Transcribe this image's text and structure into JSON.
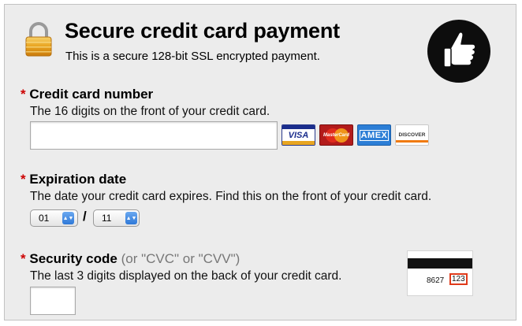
{
  "header": {
    "title": "Secure credit card payment",
    "subtitle": "This is a secure 128-bit SSL encrypted payment.",
    "lock_icon": "padlock-icon",
    "badge_icon": "thumbs-up-icon"
  },
  "required_marker": "*",
  "card_number": {
    "label": "Credit card number",
    "description": "The 16 digits on the front of your credit card.",
    "value": "",
    "logos": [
      "VISA",
      "MasterCard",
      "AMEX",
      "DISCOVER"
    ]
  },
  "expiration": {
    "label": "Expiration date",
    "description": "The date your credit card expires. Find this on the front of your credit card.",
    "month": "01",
    "year": "11",
    "separator": "/"
  },
  "security": {
    "label": "Security code",
    "hint": "(or \"CVC\" or \"CVV\")",
    "description": "The last 3 digits displayed on the back of your credit card.",
    "value": "",
    "card_number_sample": "8627",
    "code_sample": "123"
  },
  "colors": {
    "panel_bg": "#ececec",
    "required": "#cc0000",
    "select_arrow": "#2f78d8"
  }
}
